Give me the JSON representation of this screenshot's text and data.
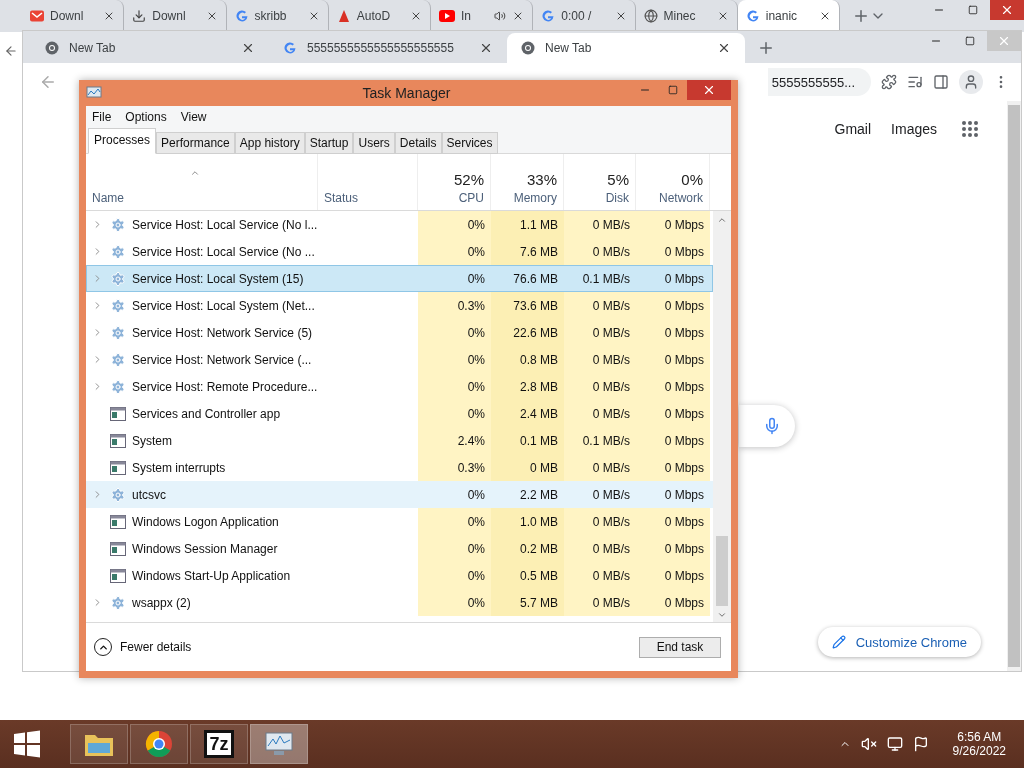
{
  "back_window": {
    "tabs": [
      {
        "title": "Downl",
        "kind": "gmail",
        "audio": false,
        "selected": false
      },
      {
        "title": "Downl",
        "kind": "download",
        "audio": false,
        "selected": false
      },
      {
        "title": "skribb",
        "kind": "google",
        "audio": false,
        "selected": false
      },
      {
        "title": "AutoD",
        "kind": "autodesk",
        "audio": false,
        "selected": false
      },
      {
        "title": "In",
        "kind": "youtube",
        "audio": true,
        "selected": false
      },
      {
        "title": "0:00 /",
        "kind": "google",
        "audio": false,
        "selected": false
      },
      {
        "title": "Minec",
        "kind": "globe",
        "audio": false,
        "selected": false
      },
      {
        "title": "inanic",
        "kind": "google",
        "audio": false,
        "selected": true
      }
    ]
  },
  "front_window": {
    "tabs": [
      {
        "title": "New Tab",
        "kind": "chrome",
        "selected": false
      },
      {
        "title": "5555555555555555555555",
        "kind": "google",
        "selected": false
      },
      {
        "title": "New Tab",
        "kind": "chrome",
        "selected": true
      }
    ],
    "address": "5555555555..."
  },
  "page": {
    "links": [
      "Gmail",
      "Images"
    ],
    "customize": "Customize Chrome"
  },
  "task_manager": {
    "title": "Task Manager",
    "menu": [
      "File",
      "Options",
      "View"
    ],
    "tabs": [
      {
        "label": "Processes",
        "selected": true
      },
      {
        "label": "Performance",
        "selected": false
      },
      {
        "label": "App history",
        "selected": false
      },
      {
        "label": "Startup",
        "selected": false
      },
      {
        "label": "Users",
        "selected": false
      },
      {
        "label": "Details",
        "selected": false
      },
      {
        "label": "Services",
        "selected": false
      }
    ],
    "name_column": "Name",
    "status_column": "Status",
    "metric_columns": [
      {
        "percent": "52%",
        "label": "CPU"
      },
      {
        "percent": "33%",
        "label": "Memory"
      },
      {
        "percent": "5%",
        "label": "Disk"
      },
      {
        "percent": "0%",
        "label": "Network"
      }
    ],
    "rows": [
      {
        "name": "Service Host: Local Service (No l...",
        "kind": "service",
        "selected": false,
        "hovered": false,
        "values": [
          "0%",
          "1.1 MB",
          "0 MB/s",
          "0 Mbps"
        ]
      },
      {
        "name": "Service Host: Local Service (No ...",
        "kind": "service",
        "selected": false,
        "hovered": false,
        "values": [
          "0%",
          "7.6 MB",
          "0 MB/s",
          "0 Mbps"
        ]
      },
      {
        "name": "Service Host: Local System (15)",
        "kind": "service",
        "selected": true,
        "hovered": false,
        "values": [
          "0%",
          "76.6 MB",
          "0.1 MB/s",
          "0 Mbps"
        ]
      },
      {
        "name": "Service Host: Local System (Net...",
        "kind": "service",
        "selected": false,
        "hovered": false,
        "values": [
          "0.3%",
          "73.6 MB",
          "0 MB/s",
          "0 Mbps"
        ]
      },
      {
        "name": "Service Host: Network Service (5)",
        "kind": "service",
        "selected": false,
        "hovered": false,
        "values": [
          "0%",
          "22.6 MB",
          "0 MB/s",
          "0 Mbps"
        ]
      },
      {
        "name": "Service Host: Network Service (...",
        "kind": "service",
        "selected": false,
        "hovered": false,
        "values": [
          "0%",
          "0.8 MB",
          "0 MB/s",
          "0 Mbps"
        ]
      },
      {
        "name": "Service Host: Remote Procedure...",
        "kind": "service",
        "selected": false,
        "hovered": false,
        "values": [
          "0%",
          "2.8 MB",
          "0 MB/s",
          "0 Mbps"
        ]
      },
      {
        "name": "Services and Controller app",
        "kind": "app",
        "selected": false,
        "hovered": false,
        "values": [
          "0%",
          "2.4 MB",
          "0 MB/s",
          "0 Mbps"
        ]
      },
      {
        "name": "System",
        "kind": "app",
        "selected": false,
        "hovered": false,
        "values": [
          "2.4%",
          "0.1 MB",
          "0.1 MB/s",
          "0 Mbps"
        ]
      },
      {
        "name": "System interrupts",
        "kind": "app",
        "selected": false,
        "hovered": false,
        "values": [
          "0.3%",
          "0 MB",
          "0 MB/s",
          "0 Mbps"
        ]
      },
      {
        "name": "utcsvc",
        "kind": "service",
        "selected": false,
        "hovered": true,
        "values": [
          "0%",
          "2.2 MB",
          "0 MB/s",
          "0 Mbps"
        ]
      },
      {
        "name": "Windows Logon Application",
        "kind": "app",
        "selected": false,
        "hovered": false,
        "values": [
          "0%",
          "1.0 MB",
          "0 MB/s",
          "0 Mbps"
        ]
      },
      {
        "name": "Windows Session Manager",
        "kind": "app",
        "selected": false,
        "hovered": false,
        "values": [
          "0%",
          "0.2 MB",
          "0 MB/s",
          "0 Mbps"
        ]
      },
      {
        "name": "Windows Start-Up Application",
        "kind": "app",
        "selected": false,
        "hovered": false,
        "values": [
          "0%",
          "0.5 MB",
          "0 MB/s",
          "0 Mbps"
        ]
      },
      {
        "name": "wsappx (2)",
        "kind": "service",
        "selected": false,
        "hovered": false,
        "values": [
          "0%",
          "5.7 MB",
          "0 MB/s",
          "0 Mbps"
        ]
      }
    ],
    "fewer_details": "Fewer details",
    "end_task": "End task"
  },
  "taskbar": {
    "apps": [
      {
        "kind": "explorer",
        "selected": false
      },
      {
        "kind": "chrome",
        "selected": false
      },
      {
        "kind": "sevenzip",
        "label": "7z",
        "selected": false
      },
      {
        "kind": "monitor",
        "selected": true
      }
    ],
    "time": "6:56 AM",
    "date": "9/26/2022"
  }
}
